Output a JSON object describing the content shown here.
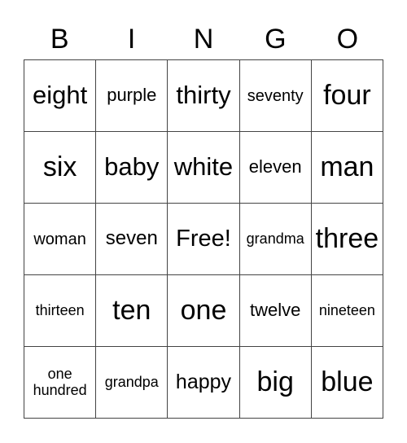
{
  "header": [
    "B",
    "I",
    "N",
    "G",
    "O"
  ],
  "cells": [
    [
      "eight",
      "purple",
      "thirty",
      "seventy",
      "four"
    ],
    [
      "six",
      "baby",
      "white",
      "eleven",
      "man"
    ],
    [
      "woman",
      "seven",
      "Free!",
      "grandma",
      "three"
    ],
    [
      "thirteen",
      "ten",
      "one",
      "twelve",
      "nineteen"
    ],
    [
      "one hundred",
      "grandpa",
      "happy",
      "big",
      "blue"
    ]
  ]
}
